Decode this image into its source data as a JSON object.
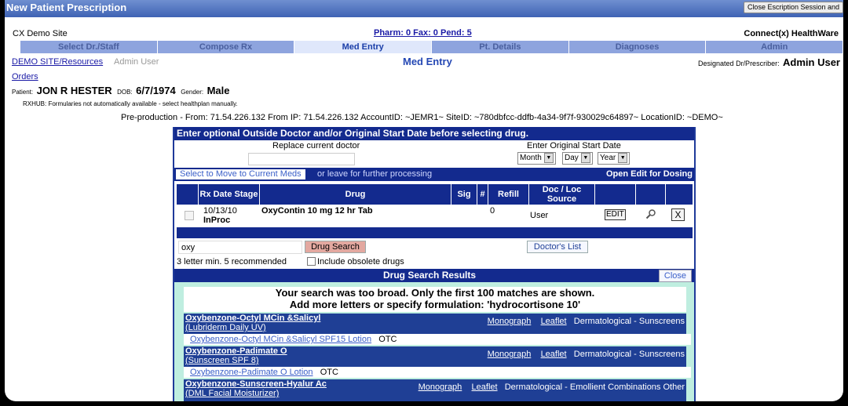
{
  "window": {
    "title": "New Patient Prescription",
    "close_button": "Close Escription Session and"
  },
  "header": {
    "site": "CX Demo Site",
    "pharm_status": "Pharm: 0  Fax: 0  Pend: 5",
    "brand": "Connect(x) HealthWare"
  },
  "tabs": [
    {
      "label": "Select Dr./Staff"
    },
    {
      "label": "Compose Rx"
    },
    {
      "label": "Med Entry"
    },
    {
      "label": "Pt. Details"
    },
    {
      "label": "Diagnoses"
    },
    {
      "label": "Admin"
    }
  ],
  "subheader": {
    "site_link": "DEMO SITE/Resources",
    "user": "Admin User",
    "page_title": "Med Entry",
    "designated_label": "Designated Dr/Prescriber:",
    "designated_value": "Admin User",
    "orders_link": "Orders"
  },
  "patient": {
    "label": "Patient:",
    "name": "JON R HESTER",
    "dob_label": "DOB:",
    "dob": "6/7/1974",
    "gender_label": "Gender:",
    "gender": "Male"
  },
  "rxhub_note": "RXHUB: Formularies not automatically available - select healthplan manually.",
  "preprod_info": "Pre-production - From: 71.54.226.132 From IP: 71.54.226.132 AccountID: ~JEMR1~ SiteID: ~780dbfcc-ddfb-4a34-9f7f-930029c64897~ LocationID: ~DEMO~",
  "outside": {
    "heading": "Enter optional Outside Doctor and/or Original Start Date before selecting drug.",
    "replace_label": "Replace current doctor",
    "start_label": "Enter Original Start Date",
    "month": "Month",
    "day": "Day",
    "year": "Year"
  },
  "actions": {
    "move_button": "Select to Move to Current Meds",
    "leave_text": "or leave for further processing",
    "open_edit": "Open Edit for Dosing"
  },
  "table": {
    "headers": [
      "Rx Date Stage",
      "Drug",
      "Sig",
      "#",
      "Refill",
      "Doc / Loc Source"
    ],
    "rows": [
      {
        "date": "10/13/10",
        "stage": "InProc",
        "drug": "OxyContin 10 mg 12 hr Tab",
        "sig": "",
        "count": "",
        "refill": "0",
        "source": "User",
        "edit": "EDIT",
        "delete": "X"
      }
    ]
  },
  "search": {
    "value": "oxy",
    "button": "Drug Search",
    "doctors_list": "Doctor's List",
    "hint": "3 letter min. 5 recommended",
    "obsolete_label": "Include obsolete drugs"
  },
  "results": {
    "heading": "Drug Search Results",
    "close": "Close",
    "notice_line1": "Your search was too broad. Only the first 100 matches are shown.",
    "notice_line2": "Add more letters or specify formulation: 'hydrocortisone 10'",
    "monograph": "Monograph",
    "leaflet": "Leaflet",
    "items": [
      {
        "name": "Oxybenzone-Octyl MCin &Salicyl",
        "brand": "(Lubriderm Daily UV)",
        "category": "Dermatological - Sunscreens",
        "product": "Oxybenzone-Octyl MCin &Salicyl SPF15 Lotion",
        "otc": "OTC"
      },
      {
        "name": "Oxybenzone-Padimate O",
        "brand": "(Sunscreen SPF 8)",
        "category": "Dermatological - Sunscreens",
        "product": "Oxybenzone-Padimate O Lotion",
        "otc": "OTC"
      },
      {
        "name": "Oxybenzone-Sunscreen-Hyalur Ac",
        "brand": "(DML Facial Moisturizer)",
        "category": "Dermatological - Emollient Combinations Other",
        "product": "",
        "otc": ""
      }
    ]
  }
}
